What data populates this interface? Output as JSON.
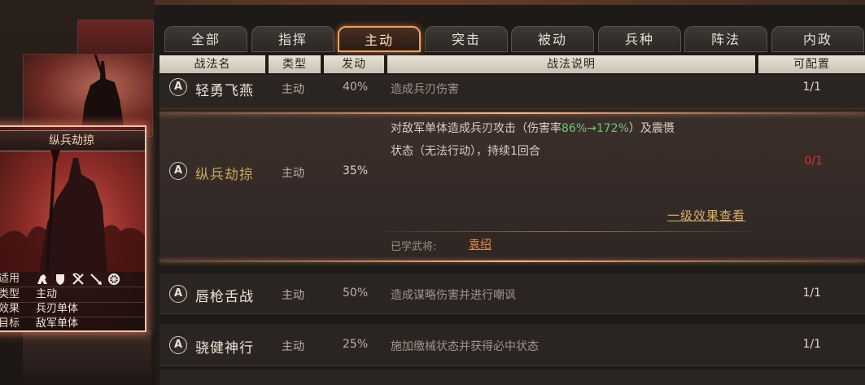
{
  "tabs": [
    {
      "label": "全部",
      "active": false
    },
    {
      "label": "指挥",
      "active": false
    },
    {
      "label": "主动",
      "active": true
    },
    {
      "label": "突击",
      "active": false
    },
    {
      "label": "被动",
      "active": false
    },
    {
      "label": "兵种",
      "active": false
    },
    {
      "label": "阵法",
      "active": false
    },
    {
      "label": "内政",
      "active": false
    }
  ],
  "header": {
    "name": "战法名",
    "type": "类型",
    "rate": "发动",
    "desc": "战法说明",
    "count": "可配置"
  },
  "rows": [
    {
      "grade": "A",
      "name": "轻勇飞燕",
      "type": "主动",
      "rate": "40%",
      "desc": "造成兵刃伤害",
      "count": "1/1"
    },
    {
      "grade": "A",
      "name": "纵兵劫掠",
      "type": "主动",
      "rate": "35%",
      "desc_line1_a": "对敌军单体造成兵刃攻击（伤害率",
      "desc_line1_hl": "86%→172%",
      "desc_line1_b": "）及震慑",
      "desc_line2": "状态（无法行动），持续1回合",
      "count": "0/1",
      "effect_link": "一级效果查看",
      "learned_label": "已学武将:",
      "learned_name": "袁绍"
    },
    {
      "grade": "A",
      "name": "唇枪舌战",
      "type": "主动",
      "rate": "50%",
      "desc": "造成谋略伤害并进行嘲讽",
      "count": "1/1"
    },
    {
      "grade": "A",
      "name": "骁健神行",
      "type": "主动",
      "rate": "25%",
      "desc": "施加缴械状态并获得必中状态",
      "count": "1/1"
    }
  ],
  "card": {
    "title": "纵兵劫掠",
    "applicable_label": "适用",
    "unit_icons": [
      "cavalry-icon",
      "shield-icon",
      "bow-icon",
      "spear-icon",
      "chariot-icon"
    ],
    "type_label": "类型",
    "type_value": "主动",
    "effect_label": "效果",
    "effect_value": "兵刃单体",
    "target_label": "目标",
    "target_value": "敌军单体"
  },
  "colors": {
    "active_tab_border": "#f0a060",
    "highlight_green": "#6cc77a",
    "count_red": "#e0342a",
    "learned_name": "#e0884e"
  }
}
